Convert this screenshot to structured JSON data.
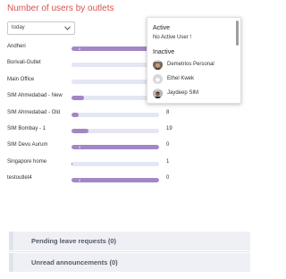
{
  "widget": {
    "title": "Number of users by outlets",
    "filter": {
      "selected": "today"
    }
  },
  "chart_data": {
    "type": "bar",
    "categories": [
      "Andheri",
      "Borivali-Outlet",
      "Main Office",
      "SIM Ahmedabad - New",
      "SIM Ahmedabad - Old",
      "SIM Bombay - 1",
      "SIM Devu Aurum",
      "Singapore home",
      "testoutlet4"
    ],
    "values": [
      0,
      0,
      0,
      14,
      8,
      19,
      0,
      1,
      0
    ],
    "bar_labels": [
      "0",
      "",
      "",
      "",
      "",
      "",
      "0",
      "",
      "0"
    ],
    "value_labels": [
      "",
      "",
      "",
      "14",
      "8",
      "19",
      "0",
      "1",
      "0"
    ],
    "colors": {
      "fill": "#a386c6",
      "track": "#e4e7f3"
    }
  },
  "popup": {
    "active_header": "Active",
    "active_note": "No Active User !",
    "inactive_header": "Inactive",
    "users": [
      {
        "name": "Demetrios Personal",
        "avatar": "person-photo"
      },
      {
        "name": "Ethel Kwek",
        "avatar": "default-avatar"
      },
      {
        "name": "Jaydeep SIM",
        "avatar": "person-photo"
      }
    ]
  },
  "sections": {
    "pending_leave": "Pending leave requests (0)",
    "unread_announcements": "Unread announcements (0)"
  },
  "colors": {
    "title": "#d9534f",
    "section_bg": "#eef0f5"
  }
}
